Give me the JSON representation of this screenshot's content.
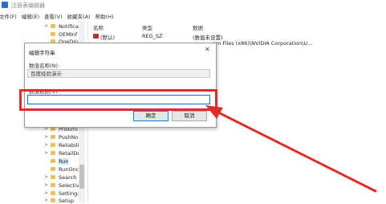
{
  "window": {
    "title": "注册表编辑器"
  },
  "menu": [
    "文件(F)",
    "编辑(E)",
    "查看(V)",
    "收藏夹(A)",
    "帮助(H)"
  ],
  "tree": {
    "items": [
      {
        "label": "Notifica"
      },
      {
        "label": "OEMInf"
      },
      {
        "label": "OneDriv"
      },
      {
        "label": "Proximi"
      },
      {
        "label": "PushNo"
      },
      {
        "label": "Reliabili"
      },
      {
        "label": "RetailDe"
      },
      {
        "label": "Run"
      },
      {
        "label": "RunOnc"
      },
      {
        "label": "Search"
      },
      {
        "label": "Selectiv"
      },
      {
        "label": "Setting:"
      },
      {
        "label": "Setup"
      }
    ],
    "selected": "Run"
  },
  "values_panel": {
    "headers": {
      "name": "名称",
      "type": "类型",
      "data": "数据"
    },
    "rows": [
      {
        "name": "(默认)",
        "type": "REG_SZ",
        "data": "(数值未设置)"
      },
      {
        "name": "",
        "type": "",
        "data": "am Files (x86)\\NVIDIA Corporation\\U..."
      }
    ]
  },
  "dialog": {
    "title": "编辑字符串",
    "close": "✕",
    "name_label": "数值名称(N):",
    "name_value": "百度经验演示",
    "data_label": "数值数据(V):",
    "data_value": "",
    "ok_label": "确定",
    "cancel_label": "取消"
  },
  "annotation": {
    "color": "#e02b2b"
  }
}
